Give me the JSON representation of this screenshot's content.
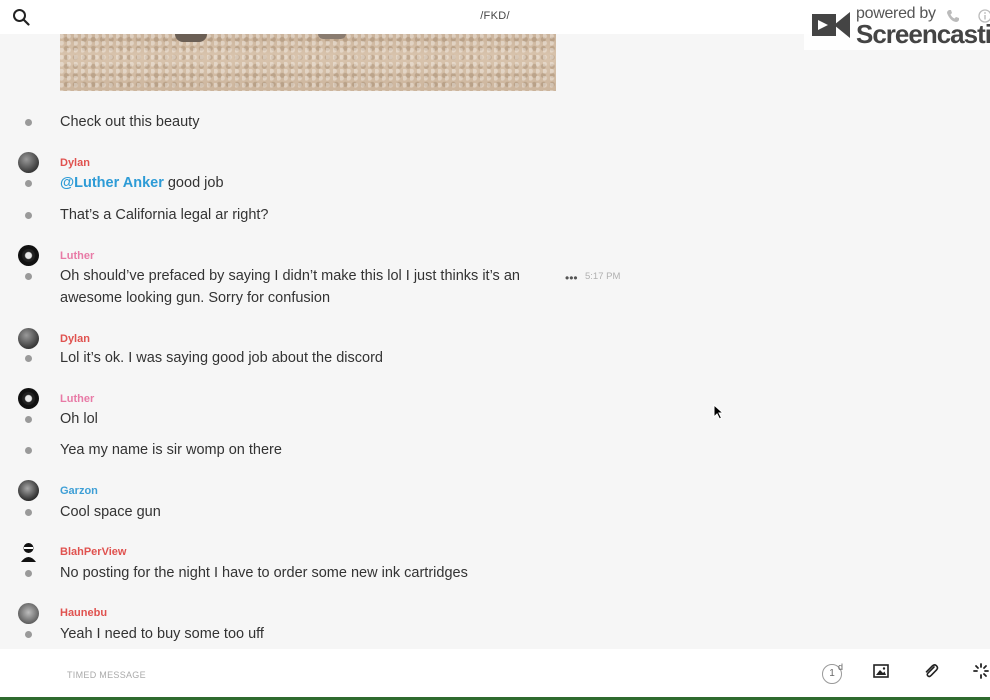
{
  "header": {
    "channel_title": "/FKD/"
  },
  "watermark": {
    "powered_by": "powered by",
    "brand": "Screencastify"
  },
  "messages": [
    {
      "text": "Check out this beauty"
    },
    {
      "author": "Dylan",
      "author_color": "#e0524f",
      "mention": "@Luther Anker",
      "text": " good job"
    },
    {
      "text": "That’s a California legal ar right?"
    },
    {
      "author": "Luther",
      "author_color": "#e87aa6",
      "text": "Oh should’ve prefaced by saying I didn’t make this lol I just thinks it’s an",
      "text2": "awesome looking gun. Sorry for confusion",
      "time": "5:17 PM"
    },
    {
      "author": "Dylan",
      "author_color": "#e0524f",
      "text": "Lol it’s ok. I was saying good job about the discord"
    },
    {
      "author": "Luther",
      "author_color": "#e87aa6",
      "text": "Oh lol"
    },
    {
      "text": "Yea my name is sir womp on there"
    },
    {
      "author": "Garzon",
      "author_color": "#3e9fd6",
      "text": "Cool space gun"
    },
    {
      "author": "BlahPerView",
      "author_color": "#e0524f",
      "text": "No posting for the night I have to order some new ink cartridges"
    },
    {
      "author": "Haunebu",
      "author_color": "#e0524f",
      "text": "Yeah I need to buy some too uff"
    }
  ],
  "composer": {
    "placeholder": "TIMED MESSAGE",
    "timer_value": "1",
    "timer_unit": "d"
  },
  "icons": {
    "search": "search-icon",
    "more": "more-icon",
    "image": "image-icon",
    "attach": "paperclip-icon",
    "loading": "spinner-icon"
  }
}
